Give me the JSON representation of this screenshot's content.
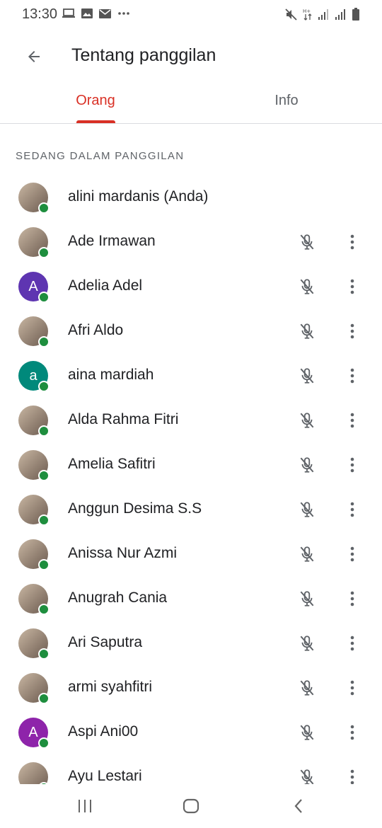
{
  "status_bar": {
    "time": "13:30",
    "icons_left": [
      "laptop-icon",
      "image-icon",
      "mail-icon",
      "more-notifications-icon"
    ],
    "icons_right": [
      "mute-icon",
      "data-arrows-icon",
      "signal-icon",
      "signal-icon",
      "battery-icon"
    ]
  },
  "header": {
    "title": "Tentang panggilan"
  },
  "tabs": [
    {
      "label": "Orang",
      "active": true
    },
    {
      "label": "Info",
      "active": false
    }
  ],
  "section_label": "SEDANG DALAM PANGGILAN",
  "participants": [
    {
      "name": "alini mardanis (Anda)",
      "avatar": "photo",
      "initial": "",
      "muted_icon": false
    },
    {
      "name": "Ade Irmawan",
      "avatar": "photo",
      "initial": "",
      "muted_icon": true
    },
    {
      "name": "Adelia Adel",
      "avatar": "letter",
      "initial": "A",
      "muted_icon": true
    },
    {
      "name": "Afri Aldo",
      "avatar": "photo",
      "initial": "",
      "muted_icon": true
    },
    {
      "name": "aina mardiah",
      "avatar": "letter",
      "initial": "a",
      "muted_icon": true
    },
    {
      "name": "Alda Rahma Fitri",
      "avatar": "photo",
      "initial": "",
      "muted_icon": true
    },
    {
      "name": "Amelia Safitri",
      "avatar": "photo",
      "initial": "",
      "muted_icon": true
    },
    {
      "name": "Anggun Desima S.S",
      "avatar": "photo",
      "initial": "",
      "muted_icon": true
    },
    {
      "name": "Anissa Nur Azmi",
      "avatar": "photo",
      "initial": "",
      "muted_icon": true
    },
    {
      "name": "Anugrah Cania",
      "avatar": "photo",
      "initial": "",
      "muted_icon": true
    },
    {
      "name": "Ari Saputra",
      "avatar": "photo",
      "initial": "",
      "muted_icon": true
    },
    {
      "name": "armi syahfitri",
      "avatar": "photo",
      "initial": "",
      "muted_icon": true
    },
    {
      "name": "Aspi Ani00",
      "avatar": "letter",
      "initial": "A",
      "muted_icon": true
    },
    {
      "name": "Ayu Lestari",
      "avatar": "photo",
      "initial": "",
      "muted_icon": true
    }
  ],
  "colors": {
    "accent": "#d93025",
    "online": "#1e8e3e",
    "avatar_purple": "#5e35b1",
    "avatar_teal": "#00897b",
    "avatar_magenta": "#8e24aa"
  },
  "nav_bar": [
    "recent-apps-icon",
    "home-icon",
    "back-icon"
  ]
}
